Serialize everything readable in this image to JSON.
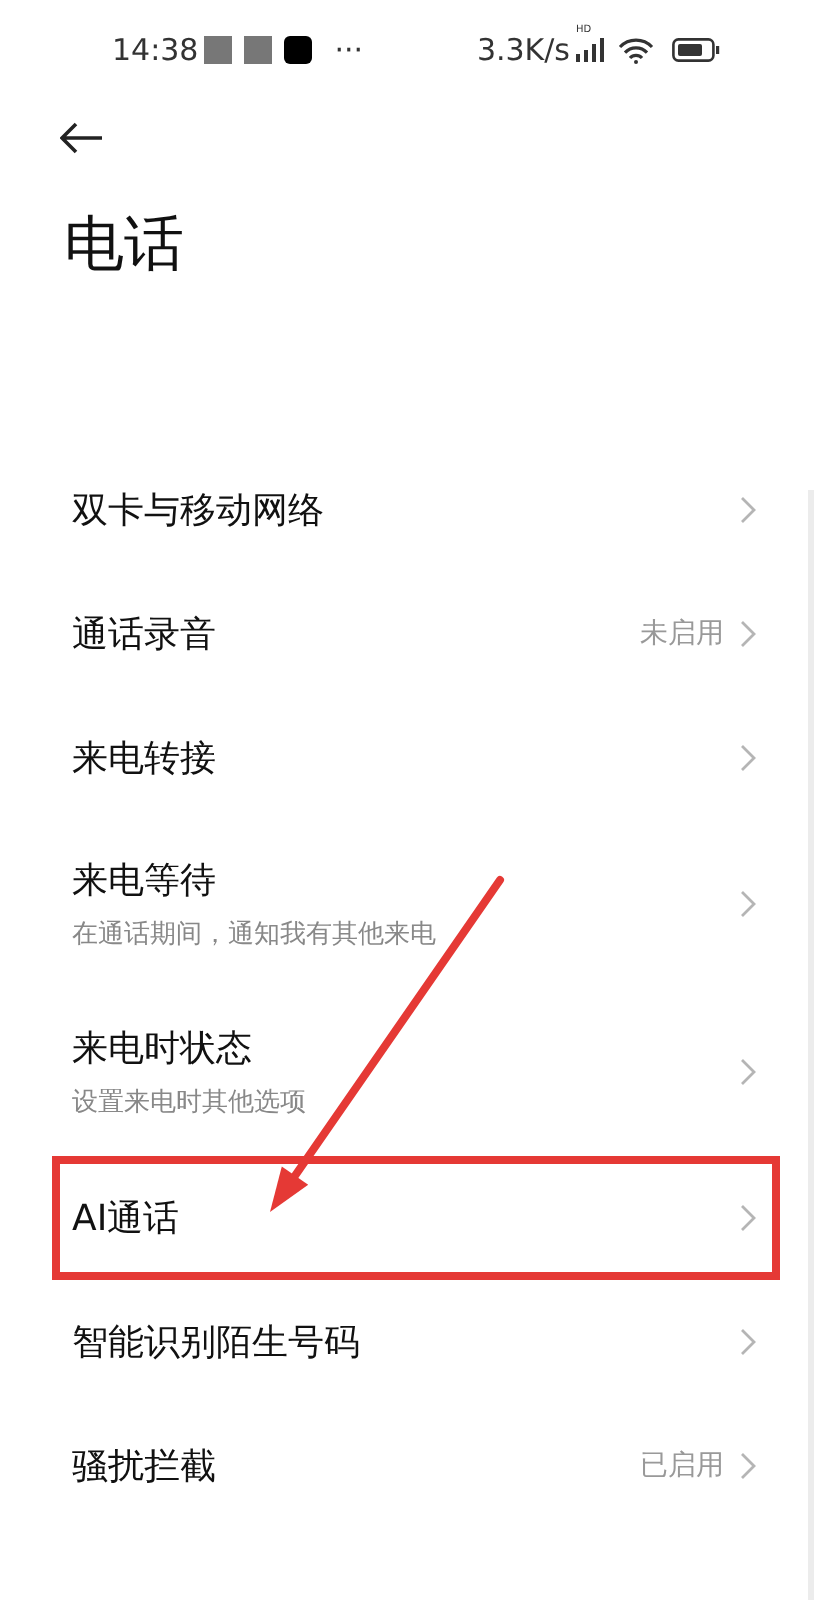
{
  "status_bar": {
    "time": "14:38",
    "more": "···",
    "speed": "3.3K/s",
    "signal_label": "HD"
  },
  "title": "电话",
  "items": [
    {
      "label": "双卡与移动网络",
      "highlighted": false
    },
    {
      "label": "通话录音",
      "value": "未启用",
      "highlighted": false
    },
    {
      "label": "来电转接",
      "highlighted": false
    },
    {
      "label": "来电等待",
      "subtitle": "在通话期间，通知我有其他来电",
      "highlighted": false
    },
    {
      "label": "来电时状态",
      "subtitle": "设置来电时其他选项",
      "highlighted": false
    },
    {
      "label": "AI通话",
      "highlighted": true
    },
    {
      "label": "智能识别陌生号码",
      "highlighted": false
    },
    {
      "label": "骚扰拦截",
      "value": "已启用",
      "highlighted": false
    }
  ]
}
